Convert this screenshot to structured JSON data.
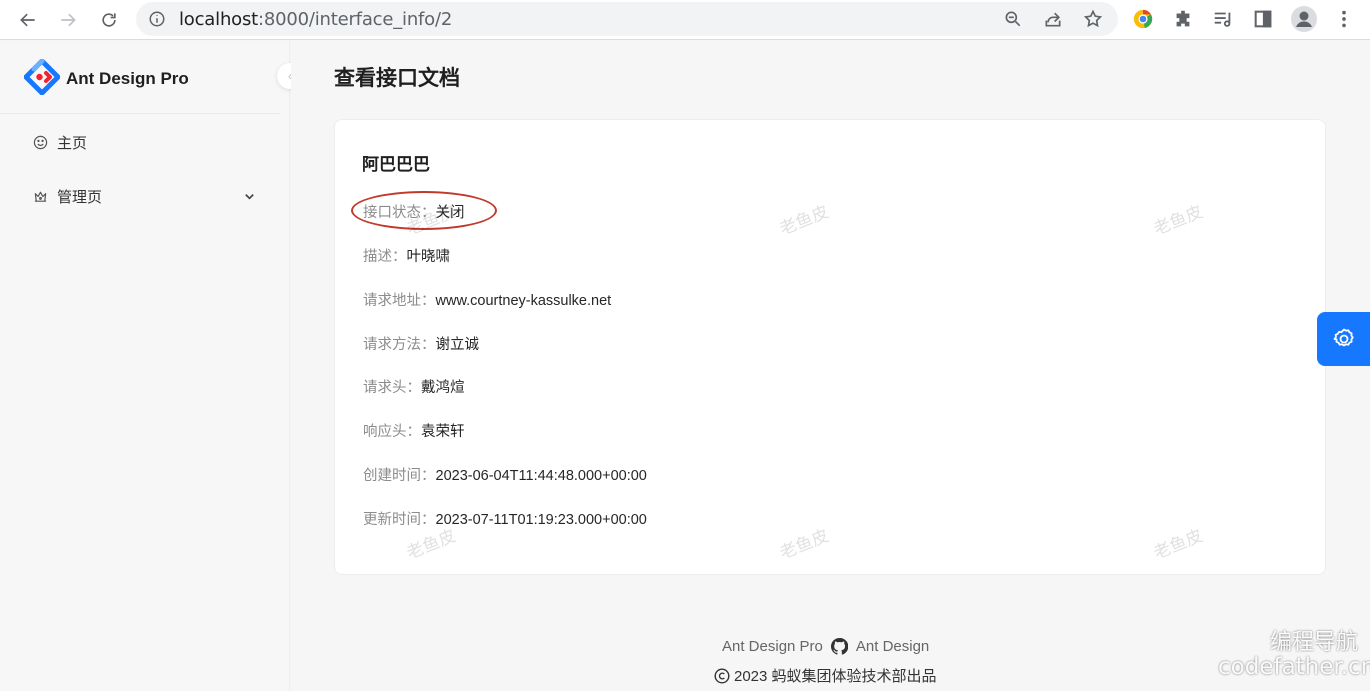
{
  "browser": {
    "url_host": "localhost",
    "url_path": ":8000/interface_info/2"
  },
  "sidebar": {
    "logo_text": "Ant Design Pro",
    "items": [
      {
        "label": "主页",
        "icon": "smile-icon"
      },
      {
        "label": "管理页",
        "icon": "crown-icon"
      }
    ]
  },
  "page": {
    "title": "查看接口文档"
  },
  "card": {
    "title": "阿巴巴巴",
    "fields": [
      {
        "label": "接口状态：",
        "value": "关闭"
      },
      {
        "label": "描述：",
        "value": "叶晓啸"
      },
      {
        "label": "请求地址：",
        "value": "www.courtney-kassulke.net"
      },
      {
        "label": "请求方法：",
        "value": "谢立诚"
      },
      {
        "label": "请求头：",
        "value": "戴鸿煊"
      },
      {
        "label": "响应头：",
        "value": "袁荣轩"
      },
      {
        "label": "创建时间：",
        "value": "2023-06-04T11:44:48.000+00:00"
      },
      {
        "label": "更新时间：",
        "value": "2023-07-11T01:19:23.000+00:00"
      }
    ],
    "watermark": "老鱼皮"
  },
  "footer": {
    "link1": "Ant Design Pro",
    "link2": "Ant Design",
    "copyright": "2023 蚂蚁集团体验技术部出品"
  },
  "overlay": {
    "brand_cn": "编程导航",
    "brand_url": "codefather.cn"
  },
  "colors": {
    "accent": "#1677ff",
    "annotation": "#c0392b"
  }
}
